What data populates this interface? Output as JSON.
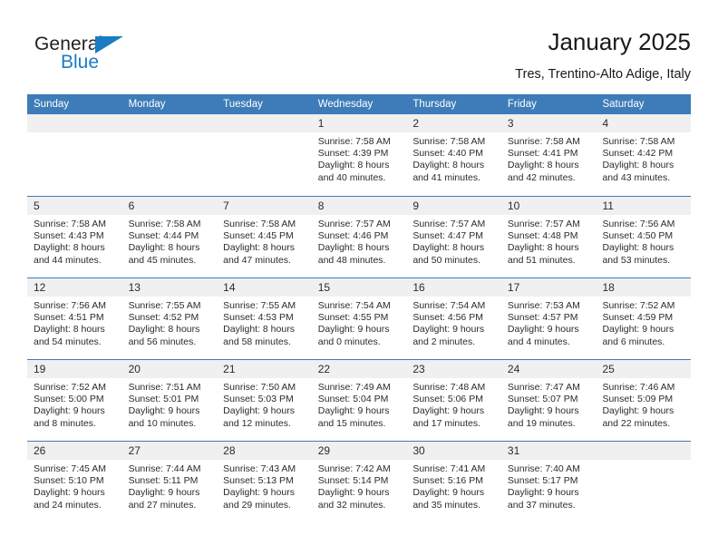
{
  "brand": {
    "name_top": "General",
    "name_bottom": "Blue",
    "accent_color": "#1a7cc4",
    "triangle_icon": "triangle-icon"
  },
  "header": {
    "title": "January 2025",
    "subtitle": "Tres, Trentino-Alto Adige, Italy"
  },
  "calendar": {
    "header_bg": "#3d7cb8",
    "day_strip_bg": "#f0f0f0",
    "weekday_headers": [
      "Sunday",
      "Monday",
      "Tuesday",
      "Wednesday",
      "Thursday",
      "Friday",
      "Saturday"
    ],
    "weeks": [
      [
        {
          "day": "",
          "empty": true,
          "sunrise": "",
          "sunset": "",
          "daylight_line1": "",
          "daylight_line2": ""
        },
        {
          "day": "",
          "empty": true,
          "sunrise": "",
          "sunset": "",
          "daylight_line1": "",
          "daylight_line2": ""
        },
        {
          "day": "",
          "empty": true,
          "sunrise": "",
          "sunset": "",
          "daylight_line1": "",
          "daylight_line2": ""
        },
        {
          "day": "1",
          "empty": false,
          "sunrise": "Sunrise: 7:58 AM",
          "sunset": "Sunset: 4:39 PM",
          "daylight_line1": "Daylight: 8 hours",
          "daylight_line2": "and 40 minutes."
        },
        {
          "day": "2",
          "empty": false,
          "sunrise": "Sunrise: 7:58 AM",
          "sunset": "Sunset: 4:40 PM",
          "daylight_line1": "Daylight: 8 hours",
          "daylight_line2": "and 41 minutes."
        },
        {
          "day": "3",
          "empty": false,
          "sunrise": "Sunrise: 7:58 AM",
          "sunset": "Sunset: 4:41 PM",
          "daylight_line1": "Daylight: 8 hours",
          "daylight_line2": "and 42 minutes."
        },
        {
          "day": "4",
          "empty": false,
          "sunrise": "Sunrise: 7:58 AM",
          "sunset": "Sunset: 4:42 PM",
          "daylight_line1": "Daylight: 8 hours",
          "daylight_line2": "and 43 minutes."
        }
      ],
      [
        {
          "day": "5",
          "empty": false,
          "sunrise": "Sunrise: 7:58 AM",
          "sunset": "Sunset: 4:43 PM",
          "daylight_line1": "Daylight: 8 hours",
          "daylight_line2": "and 44 minutes."
        },
        {
          "day": "6",
          "empty": false,
          "sunrise": "Sunrise: 7:58 AM",
          "sunset": "Sunset: 4:44 PM",
          "daylight_line1": "Daylight: 8 hours",
          "daylight_line2": "and 45 minutes."
        },
        {
          "day": "7",
          "empty": false,
          "sunrise": "Sunrise: 7:58 AM",
          "sunset": "Sunset: 4:45 PM",
          "daylight_line1": "Daylight: 8 hours",
          "daylight_line2": "and 47 minutes."
        },
        {
          "day": "8",
          "empty": false,
          "sunrise": "Sunrise: 7:57 AM",
          "sunset": "Sunset: 4:46 PM",
          "daylight_line1": "Daylight: 8 hours",
          "daylight_line2": "and 48 minutes."
        },
        {
          "day": "9",
          "empty": false,
          "sunrise": "Sunrise: 7:57 AM",
          "sunset": "Sunset: 4:47 PM",
          "daylight_line1": "Daylight: 8 hours",
          "daylight_line2": "and 50 minutes."
        },
        {
          "day": "10",
          "empty": false,
          "sunrise": "Sunrise: 7:57 AM",
          "sunset": "Sunset: 4:48 PM",
          "daylight_line1": "Daylight: 8 hours",
          "daylight_line2": "and 51 minutes."
        },
        {
          "day": "11",
          "empty": false,
          "sunrise": "Sunrise: 7:56 AM",
          "sunset": "Sunset: 4:50 PM",
          "daylight_line1": "Daylight: 8 hours",
          "daylight_line2": "and 53 minutes."
        }
      ],
      [
        {
          "day": "12",
          "empty": false,
          "sunrise": "Sunrise: 7:56 AM",
          "sunset": "Sunset: 4:51 PM",
          "daylight_line1": "Daylight: 8 hours",
          "daylight_line2": "and 54 minutes."
        },
        {
          "day": "13",
          "empty": false,
          "sunrise": "Sunrise: 7:55 AM",
          "sunset": "Sunset: 4:52 PM",
          "daylight_line1": "Daylight: 8 hours",
          "daylight_line2": "and 56 minutes."
        },
        {
          "day": "14",
          "empty": false,
          "sunrise": "Sunrise: 7:55 AM",
          "sunset": "Sunset: 4:53 PM",
          "daylight_line1": "Daylight: 8 hours",
          "daylight_line2": "and 58 minutes."
        },
        {
          "day": "15",
          "empty": false,
          "sunrise": "Sunrise: 7:54 AM",
          "sunset": "Sunset: 4:55 PM",
          "daylight_line1": "Daylight: 9 hours",
          "daylight_line2": "and 0 minutes."
        },
        {
          "day": "16",
          "empty": false,
          "sunrise": "Sunrise: 7:54 AM",
          "sunset": "Sunset: 4:56 PM",
          "daylight_line1": "Daylight: 9 hours",
          "daylight_line2": "and 2 minutes."
        },
        {
          "day": "17",
          "empty": false,
          "sunrise": "Sunrise: 7:53 AM",
          "sunset": "Sunset: 4:57 PM",
          "daylight_line1": "Daylight: 9 hours",
          "daylight_line2": "and 4 minutes."
        },
        {
          "day": "18",
          "empty": false,
          "sunrise": "Sunrise: 7:52 AM",
          "sunset": "Sunset: 4:59 PM",
          "daylight_line1": "Daylight: 9 hours",
          "daylight_line2": "and 6 minutes."
        }
      ],
      [
        {
          "day": "19",
          "empty": false,
          "sunrise": "Sunrise: 7:52 AM",
          "sunset": "Sunset: 5:00 PM",
          "daylight_line1": "Daylight: 9 hours",
          "daylight_line2": "and 8 minutes."
        },
        {
          "day": "20",
          "empty": false,
          "sunrise": "Sunrise: 7:51 AM",
          "sunset": "Sunset: 5:01 PM",
          "daylight_line1": "Daylight: 9 hours",
          "daylight_line2": "and 10 minutes."
        },
        {
          "day": "21",
          "empty": false,
          "sunrise": "Sunrise: 7:50 AM",
          "sunset": "Sunset: 5:03 PM",
          "daylight_line1": "Daylight: 9 hours",
          "daylight_line2": "and 12 minutes."
        },
        {
          "day": "22",
          "empty": false,
          "sunrise": "Sunrise: 7:49 AM",
          "sunset": "Sunset: 5:04 PM",
          "daylight_line1": "Daylight: 9 hours",
          "daylight_line2": "and 15 minutes."
        },
        {
          "day": "23",
          "empty": false,
          "sunrise": "Sunrise: 7:48 AM",
          "sunset": "Sunset: 5:06 PM",
          "daylight_line1": "Daylight: 9 hours",
          "daylight_line2": "and 17 minutes."
        },
        {
          "day": "24",
          "empty": false,
          "sunrise": "Sunrise: 7:47 AM",
          "sunset": "Sunset: 5:07 PM",
          "daylight_line1": "Daylight: 9 hours",
          "daylight_line2": "and 19 minutes."
        },
        {
          "day": "25",
          "empty": false,
          "sunrise": "Sunrise: 7:46 AM",
          "sunset": "Sunset: 5:09 PM",
          "daylight_line1": "Daylight: 9 hours",
          "daylight_line2": "and 22 minutes."
        }
      ],
      [
        {
          "day": "26",
          "empty": false,
          "sunrise": "Sunrise: 7:45 AM",
          "sunset": "Sunset: 5:10 PM",
          "daylight_line1": "Daylight: 9 hours",
          "daylight_line2": "and 24 minutes."
        },
        {
          "day": "27",
          "empty": false,
          "sunrise": "Sunrise: 7:44 AM",
          "sunset": "Sunset: 5:11 PM",
          "daylight_line1": "Daylight: 9 hours",
          "daylight_line2": "and 27 minutes."
        },
        {
          "day": "28",
          "empty": false,
          "sunrise": "Sunrise: 7:43 AM",
          "sunset": "Sunset: 5:13 PM",
          "daylight_line1": "Daylight: 9 hours",
          "daylight_line2": "and 29 minutes."
        },
        {
          "day": "29",
          "empty": false,
          "sunrise": "Sunrise: 7:42 AM",
          "sunset": "Sunset: 5:14 PM",
          "daylight_line1": "Daylight: 9 hours",
          "daylight_line2": "and 32 minutes."
        },
        {
          "day": "30",
          "empty": false,
          "sunrise": "Sunrise: 7:41 AM",
          "sunset": "Sunset: 5:16 PM",
          "daylight_line1": "Daylight: 9 hours",
          "daylight_line2": "and 35 minutes."
        },
        {
          "day": "31",
          "empty": false,
          "sunrise": "Sunrise: 7:40 AM",
          "sunset": "Sunset: 5:17 PM",
          "daylight_line1": "Daylight: 9 hours",
          "daylight_line2": "and 37 minutes."
        },
        {
          "day": "",
          "empty": true,
          "sunrise": "",
          "sunset": "",
          "daylight_line1": "",
          "daylight_line2": ""
        }
      ]
    ]
  }
}
